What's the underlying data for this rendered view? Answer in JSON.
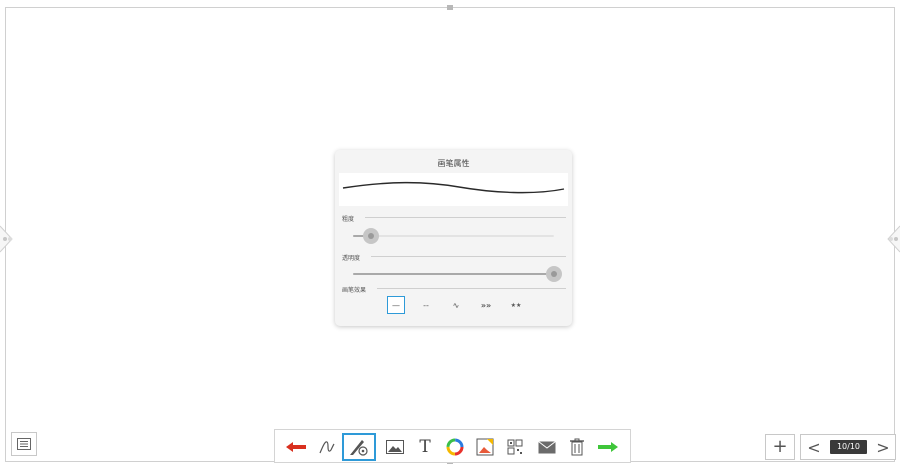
{
  "pen_panel": {
    "title": "画笔属性",
    "thickness_label": "粗度",
    "thickness_level": 0.09,
    "opacity_label": "透明度",
    "opacity_level": 1.0,
    "effect_label": "画笔效果",
    "effects": [
      {
        "name": "solid-line",
        "glyph": "—",
        "selected": true
      },
      {
        "name": "dashed-line",
        "glyph": "--",
        "selected": false
      },
      {
        "name": "wave-line",
        "glyph": "∿",
        "selected": false
      },
      {
        "name": "arrow-line",
        "glyph": "»»",
        "selected": false
      },
      {
        "name": "star-line",
        "glyph": "★★",
        "selected": false
      }
    ]
  },
  "toolbar": {
    "tools": [
      {
        "name": "undo-arrow-icon",
        "selected": false
      },
      {
        "name": "pen-icon",
        "selected": false
      },
      {
        "name": "pen-settings-icon",
        "selected": true
      },
      {
        "name": "image-icon",
        "selected": false
      },
      {
        "name": "text-icon",
        "glyph": "T",
        "selected": false
      },
      {
        "name": "color-wheel-icon",
        "selected": false
      },
      {
        "name": "background-icon",
        "selected": false
      },
      {
        "name": "qr-code-icon",
        "selected": false
      },
      {
        "name": "mail-icon",
        "selected": false
      },
      {
        "name": "trash-icon",
        "selected": false
      },
      {
        "name": "redo-arrow-icon",
        "selected": false
      }
    ]
  },
  "pager": {
    "page_count_text": "10/10",
    "add_glyph": "+",
    "prev_glyph": "<",
    "next_glyph": ">"
  },
  "colors": {
    "accent": "#2e9ad8",
    "undo": "#d9301f",
    "redo": "#3fc63a"
  }
}
